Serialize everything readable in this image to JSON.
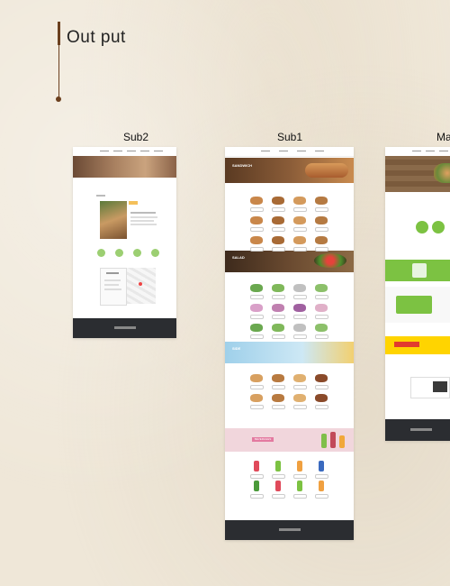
{
  "heading": {
    "title": "Out put"
  },
  "labels": {
    "sub2": "Sub2",
    "sub1": "Sub1",
    "main": "Ma"
  },
  "colors": {
    "accent_brown": "#6b3f1e",
    "footer_dark": "#2b2d31",
    "green": "#7cc242",
    "yellow": "#ffd400",
    "sky": "#bcdff2",
    "pink": "#f1d6dc"
  },
  "sub1_sections": [
    "SANDWICH",
    "SALAD",
    "SIDE",
    "BEVERAGES"
  ]
}
